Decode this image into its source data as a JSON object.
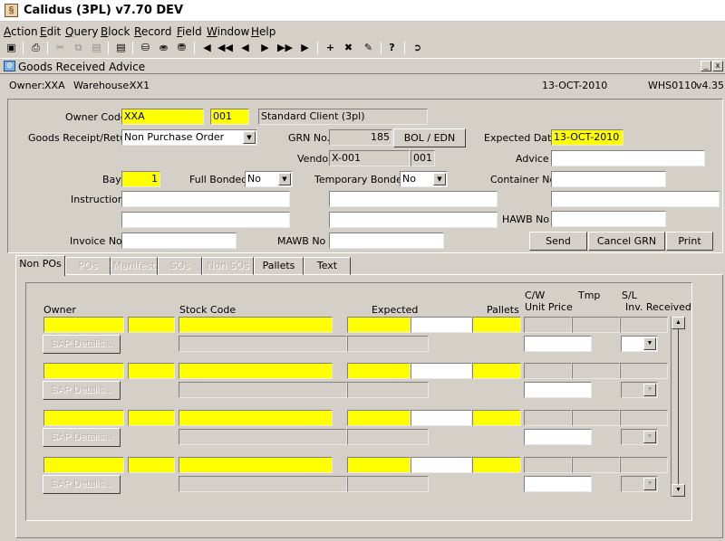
{
  "window": {
    "title": "Calidus (3PL) v7.70 DEV",
    "app_icon": "calidus-app-icon"
  },
  "menu": [
    "Action",
    "Edit",
    "Query",
    "Block",
    "Record",
    "Field",
    "Window",
    "Help"
  ],
  "menu_mnemonics": [
    "A",
    "E",
    "Q",
    "B",
    "R",
    "F",
    "W",
    "H"
  ],
  "toolbar": {
    "icons": [
      "save-icon",
      "print-icon",
      "cut-icon",
      "copy-icon",
      "paste-icon",
      "clear-icon",
      "enter-query-icon",
      "execute-query-icon",
      "cancel-query-icon",
      "first-record-icon",
      "previous-block-icon",
      "previous-record-icon",
      "next-record-icon",
      "next-block-icon",
      "last-record-icon",
      "insert-record-icon",
      "delete-record-icon",
      "duplicate-record-icon",
      "help-icon",
      "exit-icon"
    ]
  },
  "document": {
    "title": "Goods Received Advice",
    "minimize": "_",
    "close": "x"
  },
  "info": {
    "owner_label": "Owner:",
    "owner_value": "XXA",
    "warehouse_label": "Warehouse:",
    "warehouse_value": "XX1",
    "date": "13-OCT-2010",
    "form_code": "WHS0110",
    "version": "v4.35"
  },
  "header": {
    "owner_code_label": "Owner Code",
    "owner_code": "XXA",
    "owner_sub": "001",
    "owner_desc": "Standard Client (3pl)",
    "grr_label": "Goods Receipt/Return",
    "grr_value": "Non Purchase Order",
    "grn_label": "GRN No.",
    "grn_value": "185",
    "bol_button": "BOL / EDN",
    "expected_date_label": "Expected Date",
    "expected_date": "13-OCT-2010",
    "vendor_label": "Vendor",
    "vendor_value": "X-001",
    "vendor_sub": "001",
    "advice_label": "Advice",
    "advice_value": "",
    "bay_label": "Bay",
    "bay_value": "1",
    "full_bonded_label": "Full Bonded",
    "full_bonded_value": "No",
    "temp_bonded_label": "Temporary Bonded",
    "temp_bonded_value": "No",
    "container_label": "Container No.",
    "container_value": "",
    "instructions_label": "Instructions",
    "hawb_label": "HAWB No",
    "invoice_label": "Invoice No",
    "mawb_label": "MAWB No",
    "send_button": "Send",
    "cancel_grn_button": "Cancel GRN",
    "print_button": "Print"
  },
  "tabs": [
    {
      "label": "Non POs",
      "state": "active"
    },
    {
      "label": "POs",
      "state": "disabled"
    },
    {
      "label": "Manifest",
      "state": "disabled"
    },
    {
      "label": "SOs",
      "state": "disabled"
    },
    {
      "label": "Non SOs",
      "state": "disabled"
    },
    {
      "label": "Pallets",
      "state": "enabled"
    },
    {
      "label": "Text",
      "state": "enabled"
    }
  ],
  "grid": {
    "headers": {
      "owner": "Owner",
      "stock_code": "Stock Code",
      "expected": "Expected",
      "pallets": "Pallets",
      "cw": "C/W",
      "unit_price": "Unit Price",
      "tmp": "Tmp",
      "sl": "S/L",
      "inv_received": "Inv. Received"
    },
    "sap_button": "SAP Details...",
    "rows": [
      {
        "owner": "",
        "stock_code": "",
        "expected": "",
        "pallets": ""
      },
      {
        "owner": "",
        "stock_code": "",
        "expected": "",
        "pallets": ""
      },
      {
        "owner": "",
        "stock_code": "",
        "expected": "",
        "pallets": ""
      },
      {
        "owner": "",
        "stock_code": "",
        "expected": "",
        "pallets": ""
      }
    ]
  },
  "colors": {
    "mandatory": "#ffff00",
    "face": "#d4d0c8",
    "field": "#ffffff"
  }
}
